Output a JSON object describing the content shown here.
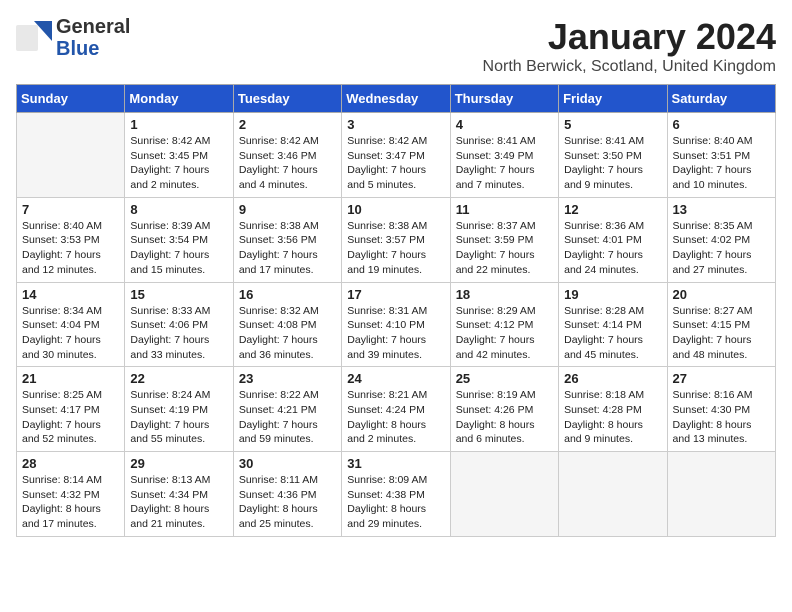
{
  "header": {
    "logo_general": "General",
    "logo_blue": "Blue",
    "month": "January 2024",
    "location": "North Berwick, Scotland, United Kingdom"
  },
  "weekdays": [
    "Sunday",
    "Monday",
    "Tuesday",
    "Wednesday",
    "Thursday",
    "Friday",
    "Saturday"
  ],
  "weeks": [
    [
      {
        "day": "",
        "empty": true
      },
      {
        "day": "1",
        "sunrise": "Sunrise: 8:42 AM",
        "sunset": "Sunset: 3:45 PM",
        "daylight": "Daylight: 7 hours and 2 minutes."
      },
      {
        "day": "2",
        "sunrise": "Sunrise: 8:42 AM",
        "sunset": "Sunset: 3:46 PM",
        "daylight": "Daylight: 7 hours and 4 minutes."
      },
      {
        "day": "3",
        "sunrise": "Sunrise: 8:42 AM",
        "sunset": "Sunset: 3:47 PM",
        "daylight": "Daylight: 7 hours and 5 minutes."
      },
      {
        "day": "4",
        "sunrise": "Sunrise: 8:41 AM",
        "sunset": "Sunset: 3:49 PM",
        "daylight": "Daylight: 7 hours and 7 minutes."
      },
      {
        "day": "5",
        "sunrise": "Sunrise: 8:41 AM",
        "sunset": "Sunset: 3:50 PM",
        "daylight": "Daylight: 7 hours and 9 minutes."
      },
      {
        "day": "6",
        "sunrise": "Sunrise: 8:40 AM",
        "sunset": "Sunset: 3:51 PM",
        "daylight": "Daylight: 7 hours and 10 minutes."
      }
    ],
    [
      {
        "day": "7",
        "sunrise": "Sunrise: 8:40 AM",
        "sunset": "Sunset: 3:53 PM",
        "daylight": "Daylight: 7 hours and 12 minutes."
      },
      {
        "day": "8",
        "sunrise": "Sunrise: 8:39 AM",
        "sunset": "Sunset: 3:54 PM",
        "daylight": "Daylight: 7 hours and 15 minutes."
      },
      {
        "day": "9",
        "sunrise": "Sunrise: 8:38 AM",
        "sunset": "Sunset: 3:56 PM",
        "daylight": "Daylight: 7 hours and 17 minutes."
      },
      {
        "day": "10",
        "sunrise": "Sunrise: 8:38 AM",
        "sunset": "Sunset: 3:57 PM",
        "daylight": "Daylight: 7 hours and 19 minutes."
      },
      {
        "day": "11",
        "sunrise": "Sunrise: 8:37 AM",
        "sunset": "Sunset: 3:59 PM",
        "daylight": "Daylight: 7 hours and 22 minutes."
      },
      {
        "day": "12",
        "sunrise": "Sunrise: 8:36 AM",
        "sunset": "Sunset: 4:01 PM",
        "daylight": "Daylight: 7 hours and 24 minutes."
      },
      {
        "day": "13",
        "sunrise": "Sunrise: 8:35 AM",
        "sunset": "Sunset: 4:02 PM",
        "daylight": "Daylight: 7 hours and 27 minutes."
      }
    ],
    [
      {
        "day": "14",
        "sunrise": "Sunrise: 8:34 AM",
        "sunset": "Sunset: 4:04 PM",
        "daylight": "Daylight: 7 hours and 30 minutes."
      },
      {
        "day": "15",
        "sunrise": "Sunrise: 8:33 AM",
        "sunset": "Sunset: 4:06 PM",
        "daylight": "Daylight: 7 hours and 33 minutes."
      },
      {
        "day": "16",
        "sunrise": "Sunrise: 8:32 AM",
        "sunset": "Sunset: 4:08 PM",
        "daylight": "Daylight: 7 hours and 36 minutes."
      },
      {
        "day": "17",
        "sunrise": "Sunrise: 8:31 AM",
        "sunset": "Sunset: 4:10 PM",
        "daylight": "Daylight: 7 hours and 39 minutes."
      },
      {
        "day": "18",
        "sunrise": "Sunrise: 8:29 AM",
        "sunset": "Sunset: 4:12 PM",
        "daylight": "Daylight: 7 hours and 42 minutes."
      },
      {
        "day": "19",
        "sunrise": "Sunrise: 8:28 AM",
        "sunset": "Sunset: 4:14 PM",
        "daylight": "Daylight: 7 hours and 45 minutes."
      },
      {
        "day": "20",
        "sunrise": "Sunrise: 8:27 AM",
        "sunset": "Sunset: 4:15 PM",
        "daylight": "Daylight: 7 hours and 48 minutes."
      }
    ],
    [
      {
        "day": "21",
        "sunrise": "Sunrise: 8:25 AM",
        "sunset": "Sunset: 4:17 PM",
        "daylight": "Daylight: 7 hours and 52 minutes."
      },
      {
        "day": "22",
        "sunrise": "Sunrise: 8:24 AM",
        "sunset": "Sunset: 4:19 PM",
        "daylight": "Daylight: 7 hours and 55 minutes."
      },
      {
        "day": "23",
        "sunrise": "Sunrise: 8:22 AM",
        "sunset": "Sunset: 4:21 PM",
        "daylight": "Daylight: 7 hours and 59 minutes."
      },
      {
        "day": "24",
        "sunrise": "Sunrise: 8:21 AM",
        "sunset": "Sunset: 4:24 PM",
        "daylight": "Daylight: 8 hours and 2 minutes."
      },
      {
        "day": "25",
        "sunrise": "Sunrise: 8:19 AM",
        "sunset": "Sunset: 4:26 PM",
        "daylight": "Daylight: 8 hours and 6 minutes."
      },
      {
        "day": "26",
        "sunrise": "Sunrise: 8:18 AM",
        "sunset": "Sunset: 4:28 PM",
        "daylight": "Daylight: 8 hours and 9 minutes."
      },
      {
        "day": "27",
        "sunrise": "Sunrise: 8:16 AM",
        "sunset": "Sunset: 4:30 PM",
        "daylight": "Daylight: 8 hours and 13 minutes."
      }
    ],
    [
      {
        "day": "28",
        "sunrise": "Sunrise: 8:14 AM",
        "sunset": "Sunset: 4:32 PM",
        "daylight": "Daylight: 8 hours and 17 minutes."
      },
      {
        "day": "29",
        "sunrise": "Sunrise: 8:13 AM",
        "sunset": "Sunset: 4:34 PM",
        "daylight": "Daylight: 8 hours and 21 minutes."
      },
      {
        "day": "30",
        "sunrise": "Sunrise: 8:11 AM",
        "sunset": "Sunset: 4:36 PM",
        "daylight": "Daylight: 8 hours and 25 minutes."
      },
      {
        "day": "31",
        "sunrise": "Sunrise: 8:09 AM",
        "sunset": "Sunset: 4:38 PM",
        "daylight": "Daylight: 8 hours and 29 minutes."
      },
      {
        "day": "",
        "empty": true
      },
      {
        "day": "",
        "empty": true
      },
      {
        "day": "",
        "empty": true
      }
    ]
  ]
}
